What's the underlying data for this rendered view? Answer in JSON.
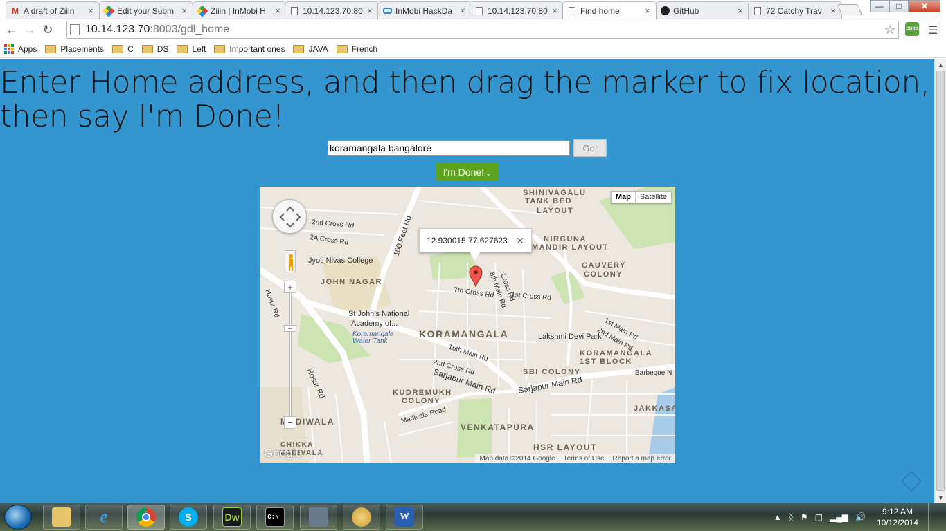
{
  "tabs": [
    {
      "label": "A draft of Ziiin",
      "icon": "gmail-icon"
    },
    {
      "label": "Edit your Subm",
      "icon": "pinwheel-icon"
    },
    {
      "label": "Ziiin | InMobi H",
      "icon": "pinwheel-icon"
    },
    {
      "label": "10.14.123.70:80",
      "icon": "page-icon"
    },
    {
      "label": "InMobi HackDa",
      "icon": "hackday-icon"
    },
    {
      "label": "10.14.123.70:80",
      "icon": "page-icon"
    },
    {
      "label": "Find home",
      "icon": "page-icon"
    },
    {
      "label": "GitHub",
      "icon": "github-icon"
    },
    {
      "label": "72 Catchy Trav",
      "icon": "page-icon"
    }
  ],
  "toolbar": {
    "url_host": "10.14.123.70",
    "url_port": ":8003",
    "url_path": "/gdl_home",
    "extension_label": "CORS"
  },
  "bookmarks": {
    "apps_label": "Apps",
    "items": [
      "Placements",
      "C",
      "DS",
      "Left",
      "Important ones",
      "JAVA",
      "French"
    ]
  },
  "page": {
    "heading": "Enter Home address, and then drag the marker to fix location, then say I'm Done!",
    "address_value": "koramangala bangalore",
    "go_label": "Go!",
    "done_label": "I'm Done!",
    "background_color": "#3496cf",
    "done_color": "#5ea31e"
  },
  "map": {
    "type_buttons": [
      "Map",
      "Satellite"
    ],
    "active_type": "Map",
    "info_coords": "12.930015,77.627623",
    "attribution": [
      "Map data ©2014 Google",
      "Terms of Use",
      "Report a map error"
    ],
    "labels": [
      "Jyoti Nivas College",
      "JOHN NAGAR",
      "St John's National",
      "Academy of...",
      "Koramangala",
      "Water Tank",
      "KORAMANGALA",
      "Lakshmi Devi Park",
      "KORAMANGALA",
      "1ST BLOCK",
      "Barbeque N",
      "SBI COLONY",
      "KUDREMUKH",
      "COLONY",
      "VENKATAPURA",
      "HSR LAYOUT",
      "MADIWALA",
      "CHIKKA",
      "MADIVALA",
      "JAKKASAND",
      "NIRGUNA",
      "MANDIR LAYOUT",
      "CAUVERY",
      "COLONY",
      "SHINIVAGALU",
      "TANK BED",
      "LAYOUT",
      "100 Feet Rd",
      "2nd Cross Rd",
      "2A Cross Rd",
      "7th Cross Rd",
      "1st Cross Rd",
      "8th Main Rd",
      "16th Main Rd",
      "2nd Cross Rd",
      "Sarjapur Main Rd",
      "Sarjapur Main Rd",
      "Madivala Road",
      "Hosur Rd",
      "Hosur Rd",
      "1st Main Rd",
      "2nd Main Rd",
      "Cross Rd",
      "Google"
    ]
  },
  "taskbar": {
    "time": "9:12 AM",
    "date": "10/12/2014",
    "apps": [
      "explorer",
      "ie",
      "chrome",
      "skype",
      "dreamweaver",
      "cmd",
      "network",
      "paint",
      "word"
    ],
    "dw_label": "Dw",
    "word_label": "W"
  }
}
